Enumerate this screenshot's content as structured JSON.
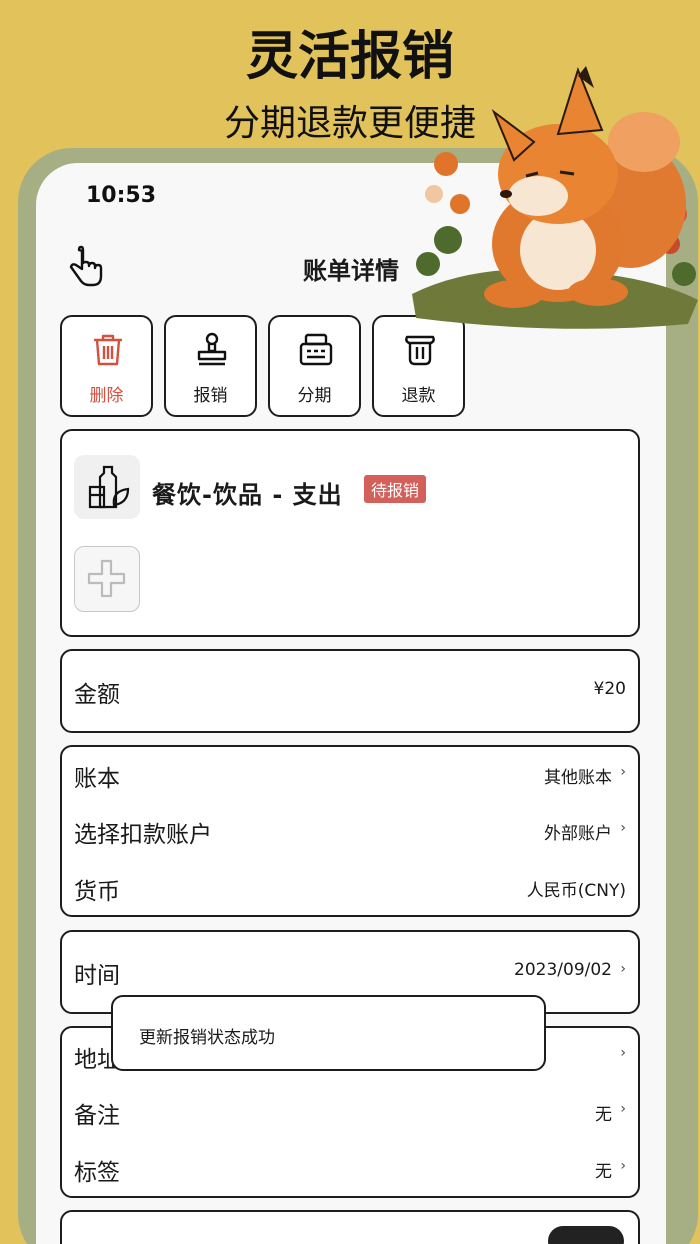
{
  "promo": {
    "title": "灵活报销",
    "subtitle": "分期退款更便捷"
  },
  "status_bar": {
    "time": "10:53"
  },
  "nav": {
    "title": "账单详情"
  },
  "actions": [
    {
      "label": "删除",
      "icon": "trash-icon",
      "color": "#D5503F"
    },
    {
      "label": "报销",
      "icon": "stamp-icon"
    },
    {
      "label": "分期",
      "icon": "installment-icon"
    },
    {
      "label": "退款",
      "icon": "refund-icon"
    }
  ],
  "record": {
    "category": "餐饮-饮品 - 支出",
    "status_badge": "待报销",
    "badge_color": "#D4605B"
  },
  "amount": {
    "label": "金额",
    "value": "¥20"
  },
  "account_section": {
    "book": {
      "label": "账本",
      "value": "其他账本"
    },
    "account": {
      "label": "选择扣款账户",
      "value": "外部账户"
    },
    "currency": {
      "label": "货币",
      "value": "人民币(CNY)"
    }
  },
  "time_section": {
    "label": "时间",
    "value": "2023/09/02"
  },
  "detail_section": {
    "location": {
      "label": "地址"
    },
    "note": {
      "label": "备注",
      "value": "无"
    },
    "tags": {
      "label": "标签",
      "value": "无"
    }
  },
  "toast": {
    "message": "更新报销状态成功"
  },
  "colors": {
    "background": "#E2C25A",
    "frame": "#A6AE84",
    "screen": "#F8F8F8"
  }
}
